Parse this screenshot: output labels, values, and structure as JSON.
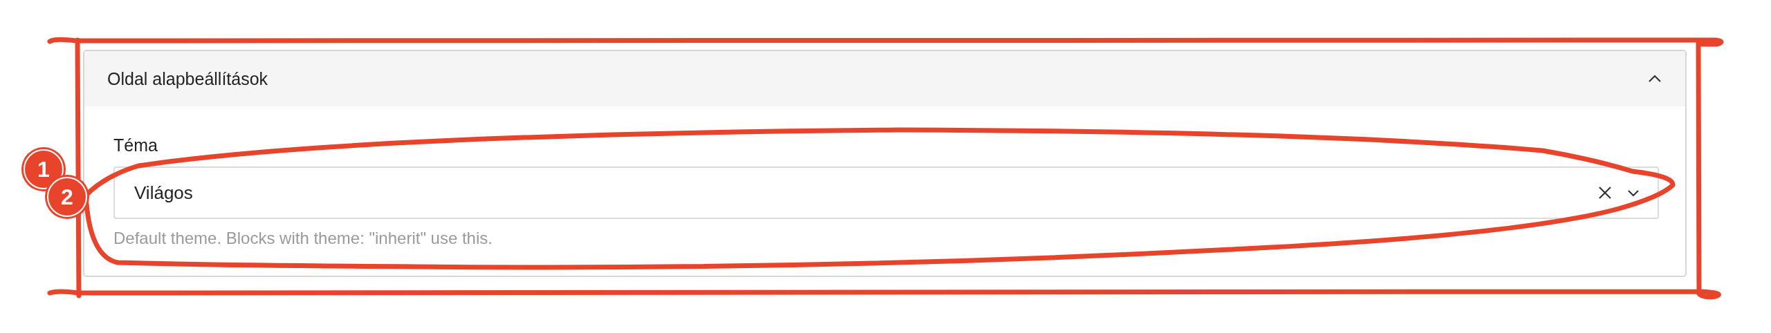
{
  "panel": {
    "title": "Oldal alapbeállítások",
    "expanded": true,
    "fields": [
      {
        "kind": "select",
        "label": "Téma",
        "value": "Világos",
        "help": "Default theme. Blocks with theme: \"inherit\" use this."
      }
    ]
  },
  "annotations": {
    "badges": [
      {
        "label": "1"
      },
      {
        "label": "2"
      }
    ]
  }
}
